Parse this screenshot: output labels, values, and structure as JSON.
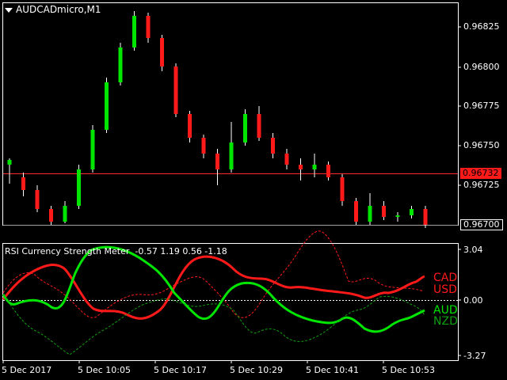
{
  "window": {
    "title": "AUDCADmicro,M1"
  },
  "main_chart": {
    "price_ticks": [
      "0.96825",
      "0.96800",
      "0.96775",
      "0.96750",
      "0.96725",
      "0.96700"
    ],
    "current_price": "0.96732",
    "bid_line_price": "0.96700",
    "colors": {
      "bull": "#00e600",
      "bear": "#ff1a1a",
      "price_line": "#ff2a2a",
      "bid_line": "#a0a0a0"
    },
    "candles": [
      [
        0.96738,
        0.96741,
        0.96742,
        0.96726,
        0.9673
      ],
      [
        0.9673,
        0.96722,
        0.96733,
        0.96718,
        0.96722
      ],
      [
        0.96722,
        0.9671,
        0.96725,
        0.96708,
        0.9671
      ],
      [
        0.9671,
        0.96702,
        0.96712,
        0.967,
        0.96702
      ],
      [
        0.96702,
        0.96712,
        0.96715,
        0.96701,
        0.96712
      ],
      [
        0.96712,
        0.96735,
        0.96738,
        0.9671,
        0.96735
      ],
      [
        0.96735,
        0.9676,
        0.96763,
        0.96733,
        0.9676
      ],
      [
        0.9676,
        0.9679,
        0.96793,
        0.96758,
        0.9679
      ],
      [
        0.9679,
        0.96812,
        0.96815,
        0.96788,
        0.96812
      ],
      [
        0.96812,
        0.96832,
        0.96835,
        0.9681,
        0.96832
      ],
      [
        0.96832,
        0.96818,
        0.96834,
        0.96815,
        0.96818
      ],
      [
        0.96818,
        0.968,
        0.9682,
        0.96797,
        0.968
      ],
      [
        0.968,
        0.9677,
        0.96802,
        0.96768,
        0.9677
      ],
      [
        0.9677,
        0.96755,
        0.96772,
        0.96752,
        0.96755
      ],
      [
        0.96755,
        0.96745,
        0.96757,
        0.96742,
        0.96745
      ],
      [
        0.96745,
        0.96735,
        0.96748,
        0.96725,
        0.96735
      ],
      [
        0.96735,
        0.96752,
        0.96765,
        0.96733,
        0.96752
      ],
      [
        0.96752,
        0.9677,
        0.96773,
        0.9675,
        0.9677
      ],
      [
        0.9677,
        0.96755,
        0.96775,
        0.96753,
        0.96755
      ],
      [
        0.96755,
        0.96745,
        0.96758,
        0.96742,
        0.96745
      ],
      [
        0.96745,
        0.96738,
        0.96748,
        0.96735,
        0.96738
      ],
      [
        0.96738,
        0.96735,
        0.96742,
        0.96728,
        0.96735
      ],
      [
        0.96735,
        0.96738,
        0.96745,
        0.9673,
        0.96738
      ],
      [
        0.96738,
        0.9673,
        0.9674,
        0.96728,
        0.9673
      ],
      [
        0.9673,
        0.96715,
        0.96732,
        0.96712,
        0.96715
      ],
      [
        0.96715,
        0.96702,
        0.96717,
        0.967,
        0.96702
      ],
      [
        0.96702,
        0.96712,
        0.9672,
        0.967,
        0.96712
      ],
      [
        0.96712,
        0.96705,
        0.96715,
        0.96703,
        0.96705
      ],
      [
        0.96705,
        0.96706,
        0.96708,
        0.96702,
        0.96706
      ],
      [
        0.96706,
        0.9671,
        0.96712,
        0.96704,
        0.9671
      ],
      [
        0.9671,
        0.967,
        0.96712,
        0.96698,
        0.967
      ]
    ]
  },
  "indicator": {
    "name": "RSI Currency Strength Meter",
    "values": "-0.57 1.19 0.56 -1.18",
    "scale_ticks": [
      "3.04",
      "0.00",
      "-3.27"
    ],
    "currencies": [
      {
        "code": "CAD",
        "color": "#ff1a1a"
      },
      {
        "code": "USD",
        "color": "#ff1a1a"
      },
      {
        "code": "AUD",
        "color": "#00e600"
      },
      {
        "code": "NZD",
        "color": "#10a010"
      }
    ]
  },
  "time_axis": [
    "5 Dec 2017",
    "5 Dec 10:05",
    "5 Dec 10:17",
    "5 Dec 10:29",
    "5 Dec 10:41",
    "5 Dec 10:53"
  ]
}
